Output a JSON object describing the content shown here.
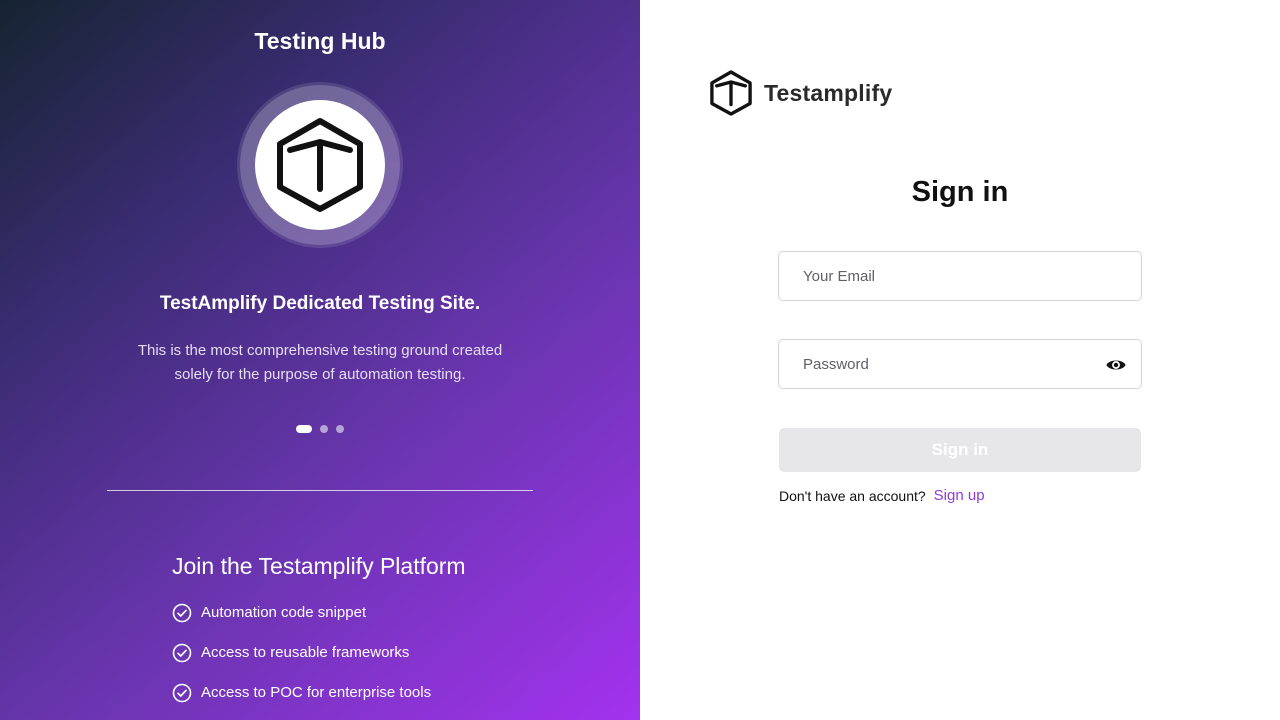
{
  "left_panel": {
    "hub_title": "Testing Hub",
    "slide_title": "TestAmplify Dedicated Testing Site.",
    "slide_description": "This is the most comprehensive testing ground created solely for the purpose of automation testing.",
    "carousel": {
      "slide_count": 3,
      "active_index": 0
    },
    "join_title": "Join the Testamplify Platform",
    "features": [
      "Automation code snippet",
      "Access to reusable frameworks",
      "Access to POC for enterprise tools"
    ]
  },
  "right_panel": {
    "brand_name": "Testamplify",
    "heading": "Sign in",
    "email_placeholder": "Your Email",
    "password_placeholder": "Password",
    "signin_button": "Sign in",
    "signup_prompt": "Don't have an account?",
    "signup_link": "Sign up"
  },
  "colors": {
    "gradient_start": "#152431",
    "gradient_end": "#a332ef",
    "link": "#8c3ade",
    "disabled_button": "#e7e7ea"
  },
  "icons": [
    "hexagon-t-logo-icon",
    "eye-icon",
    "check-circle-icon"
  ]
}
